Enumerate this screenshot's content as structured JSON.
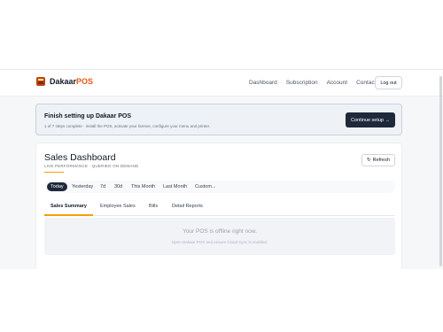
{
  "nav": {
    "logo_primary": "Dakaar",
    "logo_accent": "POS",
    "links": [
      "Dashboard",
      "Subscription",
      "Account",
      "Contact"
    ],
    "logout_label": "Log out"
  },
  "setup": {
    "title": "Finish setting up Dakaar POS",
    "subtitle": "1 of 7 steps complete · install the POS, activate your license, configure your menu and printer.",
    "button_label": "Continue setup →"
  },
  "dashboard": {
    "title": "Sales Dashboard",
    "subtitle": "LIVE PERFORMANCE · QUERIED ON DEMAND",
    "refresh_label": "Refresh",
    "ranges": [
      "Today",
      "Yesterday",
      "7d",
      "30d",
      "This Month",
      "Last Month",
      "Custom..."
    ],
    "active_range": "Today",
    "tabs": [
      "Sales Summary",
      "Employee Sales",
      "Bills",
      "Detail Reports"
    ],
    "active_tab": "Sales Summary",
    "offline_title": "Your POS is offline right now.",
    "offline_subtitle": "Open Dakaar POS and ensure Cloud Sync is enabled."
  },
  "colors": {
    "brand_accent": "#ea580c",
    "primary_dark": "#1e293b",
    "tab_accent": "#f59e0b"
  }
}
